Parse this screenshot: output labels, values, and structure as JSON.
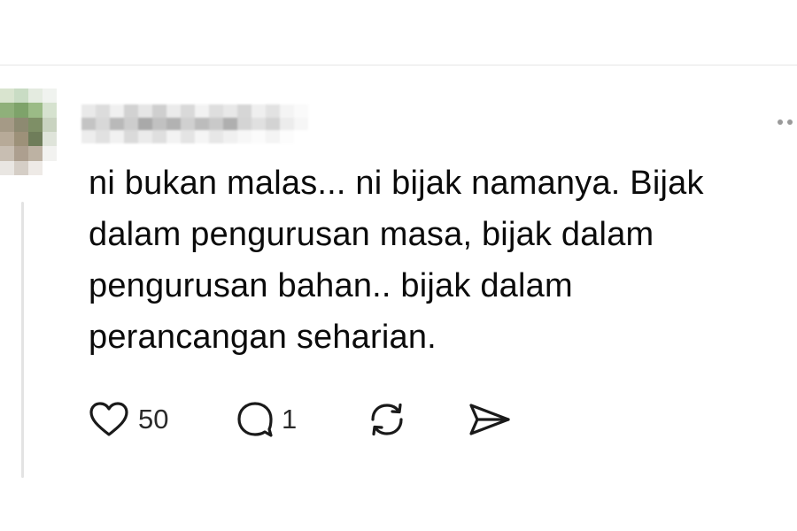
{
  "post": {
    "author_name_visible": "",
    "text_lines": [
      "ni bukan malas... ni bijak namanya. Bijak",
      "dalam pengurusan masa, bijak dalam",
      "pengurusan bahan.. bijak dalam",
      "perancangan seharian."
    ]
  },
  "actions": {
    "like": {
      "icon": "heart-icon",
      "count": "50"
    },
    "reply": {
      "icon": "comment-icon",
      "count": "1"
    },
    "repost": {
      "icon": "repost-icon"
    },
    "share": {
      "icon": "share-icon"
    }
  },
  "header": {
    "more_icon": "more-options-icon"
  },
  "colors": {
    "text": "#0b0b0b",
    "icon": "#1a1a1a",
    "divider": "#e6e6e6",
    "thread_line": "#e3e3e3"
  }
}
